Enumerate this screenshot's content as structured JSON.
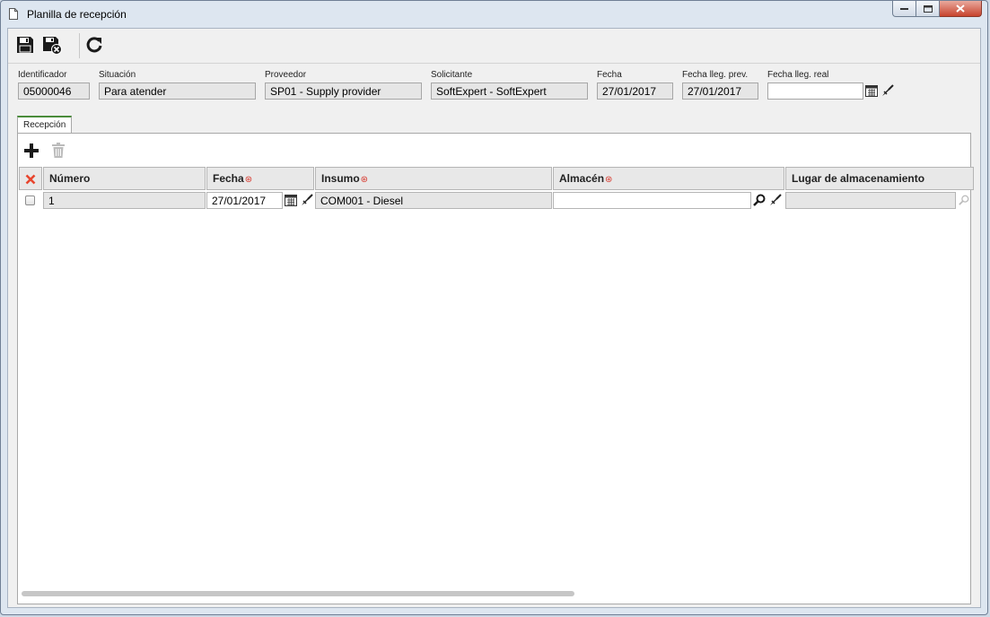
{
  "window": {
    "title": "Planilla de recepción"
  },
  "toolbar": {
    "save": "save-icon",
    "save_close": "save-close-icon",
    "refresh": "refresh-icon"
  },
  "fields": {
    "identificador": {
      "label": "Identificador",
      "value": "05000046"
    },
    "situacion": {
      "label": "Situación",
      "value": "Para atender"
    },
    "proveedor": {
      "label": "Proveedor",
      "value": "SP01 - Supply provider"
    },
    "solicitante": {
      "label": "Solicitante",
      "value": "SoftExpert - SoftExpert"
    },
    "fecha": {
      "label": "Fecha",
      "value": "27/01/2017"
    },
    "fecha_prev": {
      "label": "Fecha lleg. prev.",
      "value": "27/01/2017"
    },
    "fecha_real": {
      "label": "Fecha lleg. real",
      "value": ""
    }
  },
  "tabs": [
    {
      "label": "Recepción"
    }
  ],
  "grid": {
    "columns": [
      "Número",
      "Fecha",
      "Insumo",
      "Almacén",
      "Lugar de almacenamiento"
    ],
    "rows": [
      {
        "numero": "1",
        "fecha": "27/01/2017",
        "insumo": "COM001 - Diesel",
        "almacen": "",
        "lugar": ""
      }
    ]
  },
  "colors": {
    "required": "#d8352a",
    "close_button": "#c7432d",
    "tab_accent": "#4a8c3a"
  }
}
